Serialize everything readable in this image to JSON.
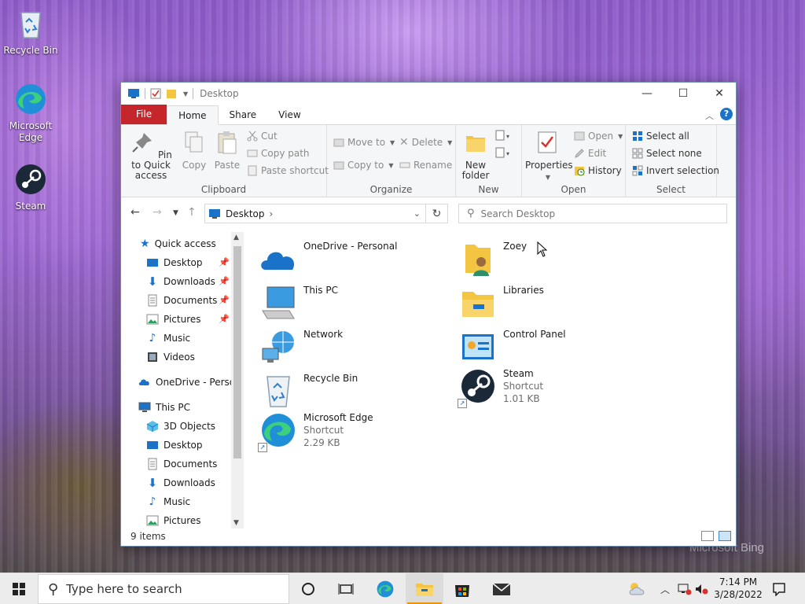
{
  "desktop": {
    "icons": [
      {
        "label": "Recycle Bin"
      },
      {
        "label": "Microsoft Edge"
      },
      {
        "label": "Steam"
      }
    ],
    "watermark": "Microsoft Bing"
  },
  "window": {
    "title": "Desktop",
    "controls": {
      "minimize": "—",
      "maximize": "☐",
      "close": "✕"
    },
    "tabs": [
      "File",
      "Home",
      "Share",
      "View"
    ],
    "ribbon": {
      "clipboard": {
        "label": "Clipboard",
        "pin": "Pin to Quick access",
        "copy": "Copy",
        "paste": "Paste",
        "cut": "Cut",
        "copy_path": "Copy path",
        "paste_shortcut": "Paste shortcut"
      },
      "organize": {
        "label": "Organize",
        "move_to": "Move to",
        "copy_to": "Copy to",
        "delete": "Delete",
        "rename": "Rename"
      },
      "new": {
        "label": "New",
        "new_folder": "New folder"
      },
      "open": {
        "label": "Open",
        "properties": "Properties",
        "open": "Open",
        "edit": "Edit",
        "history": "History"
      },
      "select": {
        "label": "Select",
        "select_all": "Select all",
        "select_none": "Select none",
        "invert": "Invert selection"
      }
    },
    "address": {
      "location": "Desktop",
      "search_placeholder": "Search Desktop"
    },
    "nav": {
      "quick_access": "Quick access",
      "qa_items": [
        "Desktop",
        "Downloads",
        "Documents",
        "Pictures",
        "Music",
        "Videos"
      ],
      "onedrive": "OneDrive - Personal",
      "this_pc": "This PC",
      "pc_items": [
        "3D Objects",
        "Desktop",
        "Documents",
        "Downloads",
        "Music",
        "Pictures"
      ]
    },
    "items": [
      {
        "name": "OneDrive - Personal",
        "sub1": "",
        "sub2": ""
      },
      {
        "name": "Zoey",
        "sub1": "",
        "sub2": ""
      },
      {
        "name": "This PC",
        "sub1": "",
        "sub2": ""
      },
      {
        "name": "Libraries",
        "sub1": "",
        "sub2": ""
      },
      {
        "name": "Network",
        "sub1": "",
        "sub2": ""
      },
      {
        "name": "Control Panel",
        "sub1": "",
        "sub2": ""
      },
      {
        "name": "Recycle Bin",
        "sub1": "",
        "sub2": ""
      },
      {
        "name": "Steam",
        "sub1": "Shortcut",
        "sub2": "1.01 KB"
      },
      {
        "name": "Microsoft Edge",
        "sub1": "Shortcut",
        "sub2": "2.29 KB"
      }
    ],
    "status": "9 items"
  },
  "taskbar": {
    "search_placeholder": "Type here to search",
    "time": "7:14 PM",
    "date": "3/28/2022"
  },
  "colors": {
    "file_tab": "#c4262b",
    "accent_blue": "#1a73c9",
    "folder_yellow": "#f4c542"
  }
}
